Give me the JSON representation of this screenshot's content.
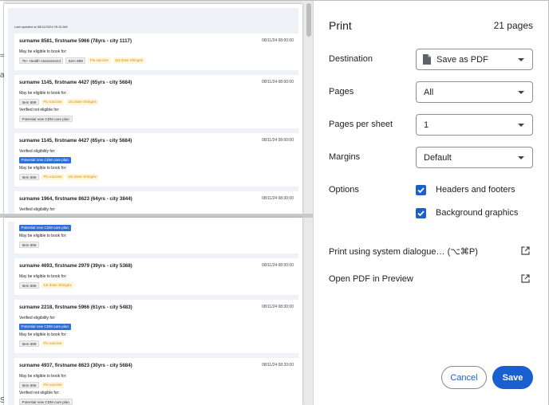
{
  "preview": {
    "last_updated": "Last updated at 08/11/2024 05:15 AM",
    "edge_chars": [
      "=",
      "a",
      "S"
    ],
    "page1_cards": [
      {
        "name": "surname 8581, firstname 5966 (78yrs - city 1117)",
        "date": "08/11/24 08:00:00",
        "lines": [
          {
            "kind": "text",
            "text": "May be eligible to book for:"
          },
          {
            "kind": "tags",
            "tags": [
              {
                "text": "75+ Health Assessment",
                "style": "grey"
              },
              {
                "text": "Item 699",
                "style": "grey"
              },
              {
                "text": "Flu vaccine",
                "style": "yellow"
              },
              {
                "text": "1st dose Shingrix",
                "style": "yellow"
              }
            ]
          }
        ]
      },
      {
        "name": "surname 1145, firstname 4427 (65yrs - city 5684)",
        "date": "08/11/24 08:00:00",
        "lines": [
          {
            "kind": "text",
            "text": "May be eligible to book for:"
          },
          {
            "kind": "tags",
            "tags": [
              {
                "text": "Item 699",
                "style": "grey"
              },
              {
                "text": "Flu vaccine",
                "style": "yellow"
              },
              {
                "text": "1st dose Shingrix",
                "style": "yellow"
              }
            ]
          },
          {
            "kind": "text",
            "text": "Verified not eligible for:"
          },
          {
            "kind": "tags",
            "tags": [
              {
                "text": "Potential new CDM care plan",
                "style": "grey"
              }
            ]
          }
        ]
      },
      {
        "name": "surname 1145, firstname 4427 (65yrs - city 5684)",
        "date": "08/11/24 08:00:00",
        "lines": [
          {
            "kind": "text",
            "text": "Verified eligibility for:"
          },
          {
            "kind": "tags",
            "tags": [
              {
                "text": "Potential new CDM care plan",
                "style": "blue"
              }
            ]
          },
          {
            "kind": "text",
            "text": "May be eligible to book for:"
          },
          {
            "kind": "tags",
            "tags": [
              {
                "text": "Item 699",
                "style": "grey"
              },
              {
                "text": "Flu vaccine",
                "style": "yellow"
              },
              {
                "text": "1st dose Shingrix",
                "style": "yellow"
              }
            ]
          }
        ]
      },
      {
        "name": "surname 1964, firstname 8623 (64yrs - city 3844)",
        "date": "08/11/24 08:00:00",
        "lines": [
          {
            "kind": "text",
            "text": "Verified eligibility for:"
          }
        ]
      }
    ],
    "page2_top": {
      "lines": [
        {
          "kind": "tags",
          "tags": [
            {
              "text": "Potential new CDM care plan",
              "style": "blue"
            }
          ]
        },
        {
          "kind": "text",
          "text": "May be eligible to book for:"
        },
        {
          "kind": "tags",
          "tags": [
            {
              "text": "Item 699",
              "style": "grey"
            }
          ]
        }
      ]
    },
    "page2_cards": [
      {
        "name": "surname 4693, firstname 2979 (39yrs - city 5368)",
        "date": "08/11/24 08:00:00",
        "lines": [
          {
            "kind": "text",
            "text": "May be eligible to book for:"
          },
          {
            "kind": "tags",
            "tags": [
              {
                "text": "Item 699",
                "style": "grey"
              },
              {
                "text": "1st dose Shingrix",
                "style": "yellow"
              }
            ]
          }
        ]
      },
      {
        "name": "surname 2218, firstname 5966 (61yrs - city 5483)",
        "date": "08/11/24 08:00:00",
        "lines": [
          {
            "kind": "text",
            "text": "Verified eligibility for:"
          },
          {
            "kind": "tags",
            "tags": [
              {
                "text": "Potential new CDM care plan",
                "style": "blue"
              }
            ]
          },
          {
            "kind": "text",
            "text": "May be eligible to book for:"
          },
          {
            "kind": "tags",
            "tags": [
              {
                "text": "Item 699",
                "style": "grey"
              },
              {
                "text": "Flu vaccine",
                "style": "yellow"
              }
            ]
          }
        ]
      },
      {
        "name": "surname 4937, firstname 8623 (30yrs - city 5684)",
        "date": "08/11/24 08:20:00",
        "lines": [
          {
            "kind": "text",
            "text": "May be eligible to book for:"
          },
          {
            "kind": "tags",
            "tags": [
              {
                "text": "Item 699",
                "style": "grey"
              },
              {
                "text": "Flu vaccine",
                "style": "yellow"
              }
            ]
          },
          {
            "kind": "text",
            "text": "Verified not eligible for:"
          },
          {
            "kind": "tags",
            "tags": [
              {
                "text": "Potential new CDM care plan",
                "style": "grey"
              }
            ]
          }
        ]
      }
    ]
  },
  "panel": {
    "title": "Print",
    "page_count": "21 pages",
    "destination": {
      "label": "Destination",
      "value": "Save as PDF",
      "icon": "file-icon"
    },
    "pages": {
      "label": "Pages",
      "value": "All"
    },
    "pages_per_sheet": {
      "label": "Pages per sheet",
      "value": "1"
    },
    "margins": {
      "label": "Margins",
      "value": "Default"
    },
    "options": {
      "label": "Options",
      "headers_footers": {
        "label": "Headers and footers",
        "checked": true
      },
      "background_graphics": {
        "label": "Background graphics",
        "checked": true
      }
    },
    "system_dialogue": {
      "label": "Print using system dialogue… (⌥⌘P)",
      "icon": "open-external-icon"
    },
    "open_pdf": {
      "label": "Open PDF in Preview",
      "icon": "open-external-icon"
    },
    "cancel_label": "Cancel",
    "save_label": "Save"
  },
  "colors": {
    "accent": "#1a5fd0",
    "tag_blue": "#2f6fd6",
    "tag_yellow_text": "#d4880a",
    "tag_yellow_bg": "#fff6dd",
    "preview_bg": "#e9e9ea"
  }
}
